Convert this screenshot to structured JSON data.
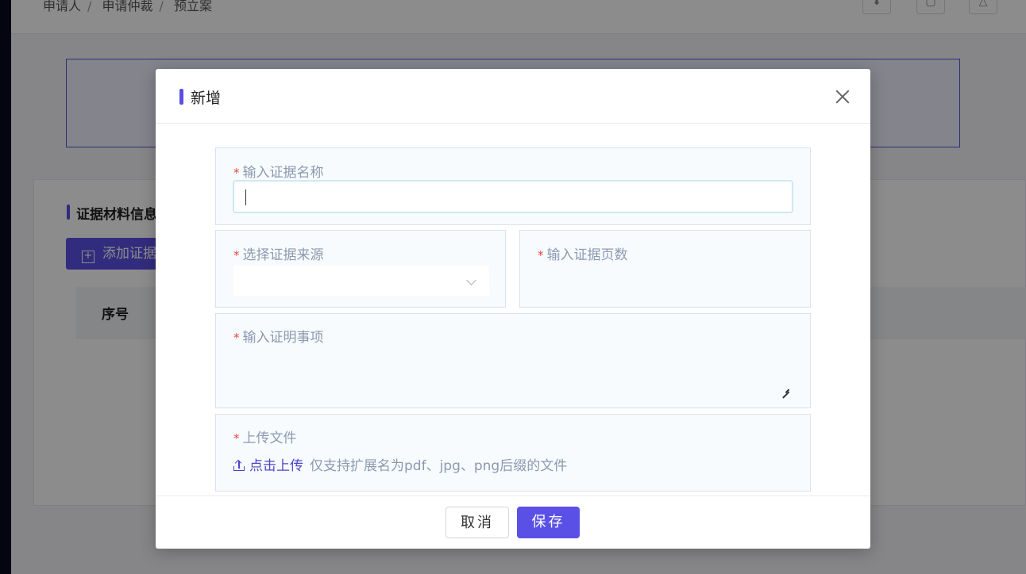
{
  "background": {
    "breadcrumb": [
      "申请人",
      "申请仲裁",
      "预立案"
    ],
    "section_title": "证据材料信息",
    "add_button": "添加证据",
    "table_header_seq": "序号"
  },
  "modal": {
    "title": "新增",
    "fields": {
      "evidence_name": {
        "label": "输入证据名称",
        "value": ""
      },
      "evidence_source": {
        "label": "选择证据来源",
        "value": ""
      },
      "evidence_pages": {
        "label": "输入证据页数",
        "value": ""
      },
      "proof_matter": {
        "label": "输入证明事项",
        "value": ""
      },
      "upload": {
        "label": "上传文件",
        "link_text": "点击上传",
        "hint": "仅支持扩展名为pdf、jpg、png后缀的文件"
      }
    },
    "required_mark": "*",
    "cancel_label": "取消",
    "save_label": "保存"
  },
  "colors": {
    "accent": "#5b50e6",
    "required": "#e54545",
    "field_bg": "#f8fbfd",
    "label": "#8b9ab0"
  }
}
